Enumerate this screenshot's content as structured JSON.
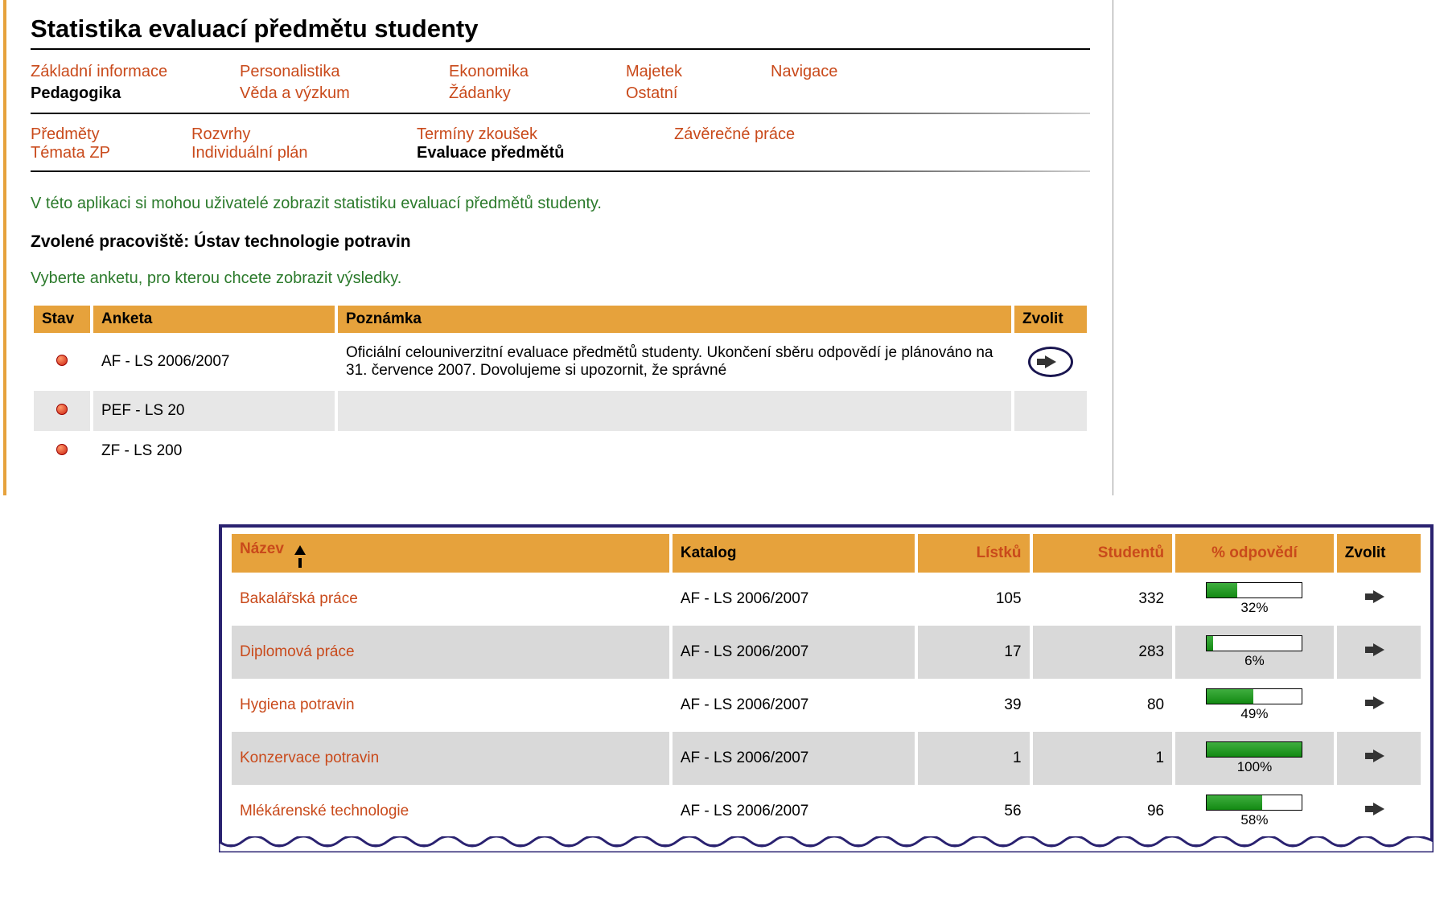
{
  "page_title": "Statistika evaluací předmětu studenty",
  "nav": {
    "row1": [
      {
        "label": "Základní informace",
        "active": false
      },
      {
        "label": "Personalistika",
        "active": false
      },
      {
        "label": "Ekonomika",
        "active": false
      },
      {
        "label": "Majetek",
        "active": false
      },
      {
        "label": "Navigace",
        "active": false
      }
    ],
    "row2": [
      {
        "label": "Pedagogika",
        "active": true
      },
      {
        "label": "Věda a výzkum",
        "active": false
      },
      {
        "label": "Žádanky",
        "active": false
      },
      {
        "label": "Ostatní",
        "active": false
      }
    ]
  },
  "subnav": {
    "row1": [
      {
        "label": "Předměty",
        "active": false
      },
      {
        "label": "Rozvrhy",
        "active": false
      },
      {
        "label": "Termíny zkoušek",
        "active": false
      },
      {
        "label": "Závěrečné práce",
        "active": false
      }
    ],
    "row2": [
      {
        "label": "Témata ZP",
        "active": false
      },
      {
        "label": "Individuální plán",
        "active": false
      },
      {
        "label": "Evaluace předmětů",
        "active": true
      }
    ]
  },
  "intro_text": "V této aplikaci si mohou uživatelé zobrazit statistiku evaluací předmětů studenty.",
  "workplace_label": "Zvolené pracoviště: ",
  "workplace_value": "Ústav technologie potravin",
  "prompt_text": "Vyberte anketu, pro kterou chcete zobrazit výsledky.",
  "surveys_table": {
    "headers": {
      "stav": "Stav",
      "anketa": "Anketa",
      "poznamka": "Poznámka",
      "zvolit": "Zvolit"
    },
    "rows": [
      {
        "status": "red",
        "anketa": "AF - LS 2006/2007",
        "pozn": "Oficiální celouniverzitní evaluace předmětů studenty. Ukončení sběru odpovědí je plánováno na 31. července 2007. Dovolujeme si upozornit, že správné",
        "circled": true,
        "alt": false
      },
      {
        "status": "red",
        "anketa": "PEF - LS 20",
        "pozn": "",
        "circled": false,
        "alt": true
      },
      {
        "status": "red",
        "anketa": "ZF - LS 200",
        "pozn": "",
        "circled": false,
        "alt": false
      }
    ]
  },
  "subjects_table": {
    "headers": {
      "nazev": "Název",
      "katalog": "Katalog",
      "listku": "Lístků",
      "studentu": "Studentů",
      "odpovedi": "% odpovědí",
      "zvolit": "Zvolit"
    },
    "rows": [
      {
        "nazev": "Bakalářská práce",
        "katalog": "AF - LS 2006/2007",
        "listku": "105",
        "studentu": "332",
        "pct": 32,
        "pct_label": "32%",
        "alt": false
      },
      {
        "nazev": "Diplomová práce",
        "katalog": "AF - LS 2006/2007",
        "listku": "17",
        "studentu": "283",
        "pct": 6,
        "pct_label": "6%",
        "alt": true
      },
      {
        "nazev": "Hygiena potravin",
        "katalog": "AF - LS 2006/2007",
        "listku": "39",
        "studentu": "80",
        "pct": 49,
        "pct_label": "49%",
        "alt": false
      },
      {
        "nazev": "Konzervace potravin",
        "katalog": "AF - LS 2006/2007",
        "listku": "1",
        "studentu": "1",
        "pct": 100,
        "pct_label": "100%",
        "alt": true
      },
      {
        "nazev": "Mlékárenské technologie",
        "katalog": "AF - LS 2006/2007",
        "listku": "56",
        "studentu": "96",
        "pct": 58,
        "pct_label": "58%",
        "alt": false
      }
    ]
  }
}
